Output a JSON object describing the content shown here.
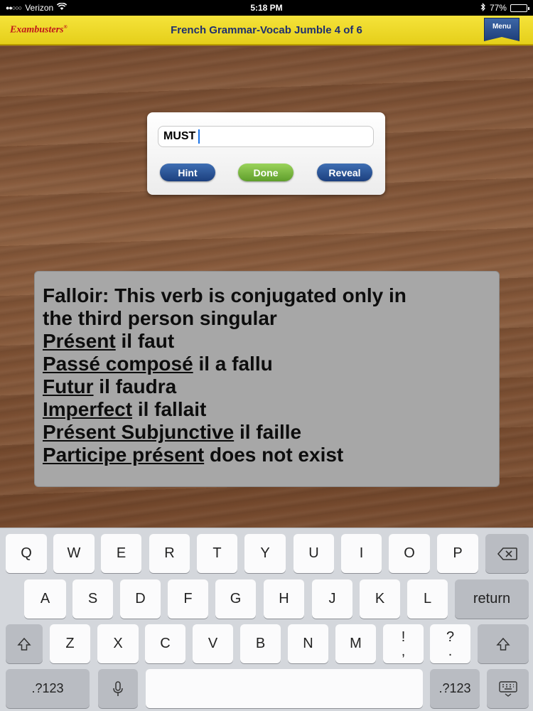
{
  "status_bar": {
    "carrier": "Verizon",
    "time": "5:18 PM",
    "battery": "77%",
    "battery_level": 0.77
  },
  "header": {
    "logo": "Exambusters",
    "logo_mark": "®",
    "title": "French Grammar-Vocab Jumble 4 of 6",
    "menu_label": "Menu"
  },
  "answer": {
    "value": "MUST",
    "hint_label": "Hint",
    "done_label": "Done",
    "reveal_label": "Reveal"
  },
  "clue": {
    "line1": "Falloir: This verb is conjugated only in",
    "line2": "the third person singular",
    "rows": [
      {
        "term": "Présent",
        "rest": " il faut"
      },
      {
        "term": "Passé composé",
        "rest": " il a fallu"
      },
      {
        "term": "Futur",
        "rest": " il faudra"
      },
      {
        "term": "Imperfect",
        "rest": " il fallait"
      },
      {
        "term": "Présent Subjunctive",
        "rest": " il faille"
      },
      {
        "term": "Participe présent",
        "rest": " does not exist"
      }
    ]
  },
  "keyboard": {
    "row1": [
      "Q",
      "W",
      "E",
      "R",
      "T",
      "Y",
      "U",
      "I",
      "O",
      "P"
    ],
    "row2": [
      "A",
      "S",
      "D",
      "F",
      "G",
      "H",
      "J",
      "K",
      "L"
    ],
    "row3": [
      "Z",
      "X",
      "C",
      "V",
      "B",
      "N",
      "M"
    ],
    "return_label": "return",
    "exclaim_top": "!",
    "exclaim_bottom": ",",
    "question_top": "?",
    "question_bottom": ".",
    "numbers_left": ".?123",
    "numbers_right": ".?123"
  },
  "icons": {
    "wifi": "wifi-icon",
    "bluetooth": "bluetooth-icon",
    "backspace": "backspace-icon",
    "shift": "shift-icon",
    "microphone": "microphone-icon",
    "hide_keyboard": "keyboard-hide-icon"
  }
}
